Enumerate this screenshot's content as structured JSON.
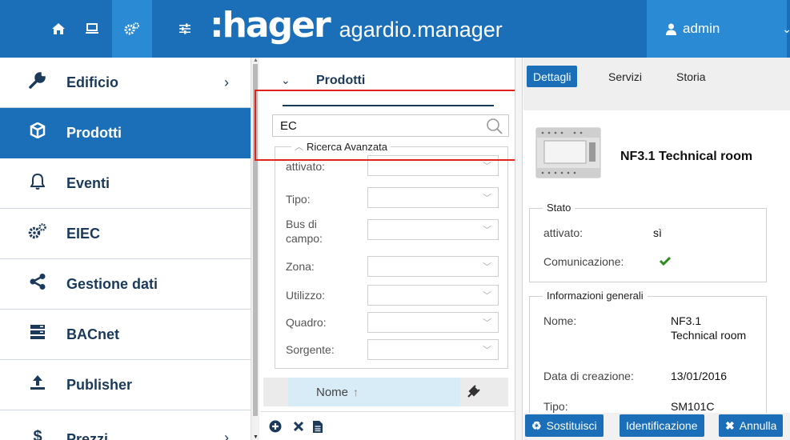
{
  "topbar": {
    "brand_logo": ":hager",
    "brand_product": "agardio.manager",
    "user": "admin",
    "icons": [
      "home-icon",
      "monitor-icon",
      "gears-icon",
      "sliders-icon",
      "user-icon"
    ],
    "colors": {
      "bar": "#1a6fb8",
      "active": "#2a8ad4"
    }
  },
  "sidebar": {
    "items": [
      {
        "label": "Edificio",
        "icon": "wrench-icon",
        "has_submenu": true
      },
      {
        "label": "Prodotti",
        "icon": "cube-icon",
        "active": true
      },
      {
        "label": "Eventi",
        "icon": "bell-icon"
      },
      {
        "label": "EIEC",
        "icon": "gears-icon"
      },
      {
        "label": "Gestione dati",
        "icon": "share-icon"
      },
      {
        "label": "BACnet",
        "icon": "server-icon"
      },
      {
        "label": "Publisher",
        "icon": "upload-icon"
      },
      {
        "label": "Prezzi",
        "icon": "dollar-icon",
        "has_submenu": true
      }
    ]
  },
  "products": {
    "title": "Prodotti",
    "search_value": "EC",
    "advanced_search": {
      "legend": "Ricerca Avanzata",
      "fields": [
        {
          "label": "attivato:"
        },
        {
          "label": "Tipo:"
        },
        {
          "label": "Bus di campo:"
        },
        {
          "label": "Zona:"
        },
        {
          "label": "Utilizzo:"
        },
        {
          "label": "Quadro:"
        },
        {
          "label": "Sorgente:"
        }
      ]
    },
    "table": {
      "column_name": "Nome",
      "sort": "↑"
    },
    "footer_icons": [
      "add-circle-icon",
      "delete-icon",
      "document-icon"
    ]
  },
  "details": {
    "tabs": [
      "Dettagli",
      "Servizi",
      "Storia"
    ],
    "active_tab": "Dettagli",
    "product_title": "NF3.1 Technical room",
    "stato": {
      "legend": "Stato",
      "attivato_label": "attivato:",
      "attivato_value": "sì",
      "comunicazione_label": "Comunicazione:",
      "comunicazione_icon": "check-icon"
    },
    "info": {
      "legend": "Informazioni generali",
      "nome_label": "Nome:",
      "nome_value": "NF3.1 Technical room",
      "data_label": "Data di creazione:",
      "data_value": "13/01/2016",
      "tipo_label": "Tipo:",
      "tipo_value": "SM101C"
    },
    "actions": {
      "replace": "Sostituisci",
      "identify": "Identificazione",
      "cancel": "Annulla"
    }
  },
  "colors": {
    "accent": "#1a6fb8",
    "navy": "#1b3a5a",
    "highlight": "#e0241d",
    "check": "#2e8b1f"
  }
}
